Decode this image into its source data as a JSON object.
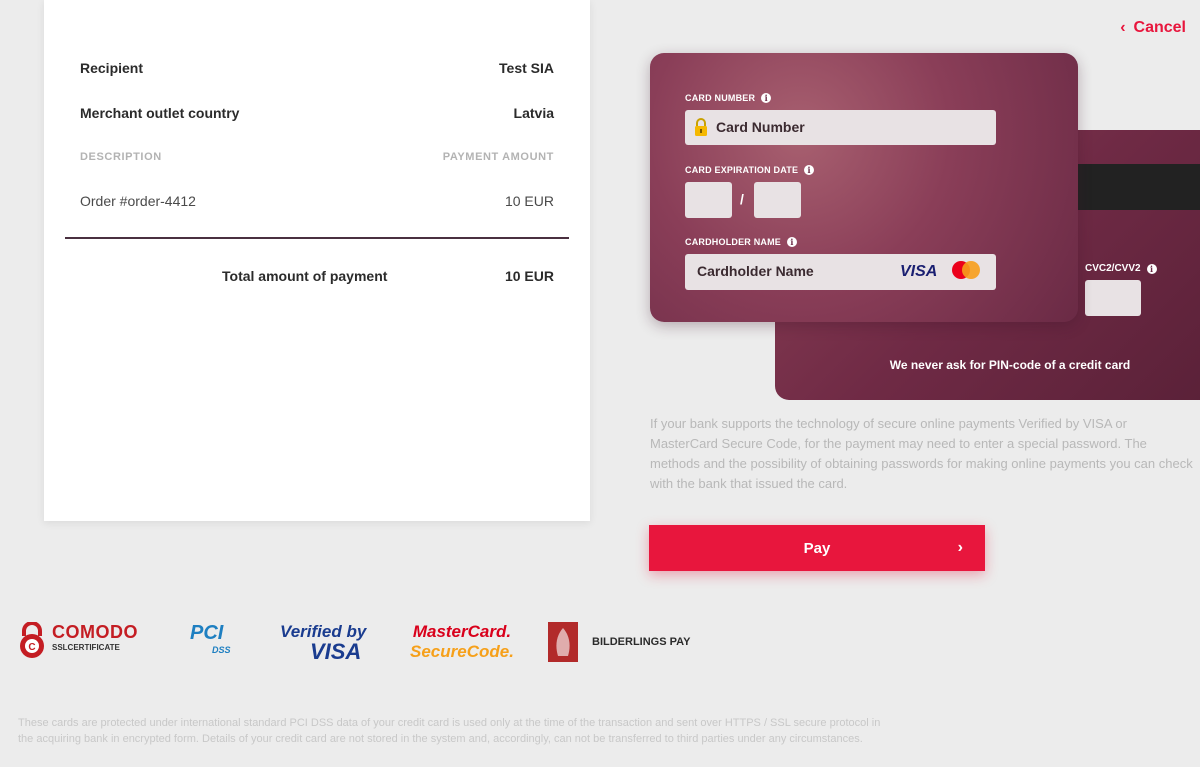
{
  "cancel": {
    "label": "Cancel",
    "icon": "chevron-left-icon"
  },
  "summary": {
    "recipient_label": "Recipient",
    "recipient_value": "Test SIA",
    "country_label": "Merchant outlet country",
    "country_value": "Latvia",
    "col_description": "DESCRIPTION",
    "col_amount": "PAYMENT AMOUNT",
    "order_description": "Order #order-4412",
    "order_amount": "10 EUR",
    "total_label": "Total amount of payment",
    "total_amount": "10 EUR"
  },
  "card": {
    "number_label": "CARD NUMBER",
    "number_placeholder": "Card Number",
    "expiry_label": "CARD EXPIRATION DATE",
    "expiry_separator": "/",
    "holder_label": "CARDHOLDER NAME",
    "holder_placeholder": "Cardholder Name",
    "visa": "VISA",
    "cvc_label": "CVC2/CVV2",
    "pin_note": "We never ask for PIN-code of a credit card",
    "info_icon": "i"
  },
  "bank_note": "If your bank supports the technology of secure online payments Verified by VISA or MasterCard Secure Code, for the payment may need to enter a special password. The methods and the possibility of obtaining passwords for making online payments you can check with the bank that issued the card.",
  "pay_button": {
    "label": "Pay",
    "chevron": "›"
  },
  "logos": {
    "comodo": "COMODO",
    "comodo_sub": "SSLCERTIFICATE",
    "pci": "PCI",
    "pci_sub": "DSS",
    "vbv_top": "Verified by",
    "vbv_bottom": "VISA",
    "msc_top": "MasterCard.",
    "msc_bottom": "SecureCode.",
    "bilderlings": "BILDERLINGS PAY"
  },
  "footer_note": "These cards are protected under international standard PCI DSS data of your credit card is used only at the time of the transaction and sent over HTTPS / SSL secure protocol in the acquiring bank in encrypted form. Details of your credit card are not stored in the system and, accordingly, can not be transferred to third parties under any circumstances.",
  "colors": {
    "accent": "#e8163d",
    "card": "#7a3350",
    "background": "#ececec"
  }
}
